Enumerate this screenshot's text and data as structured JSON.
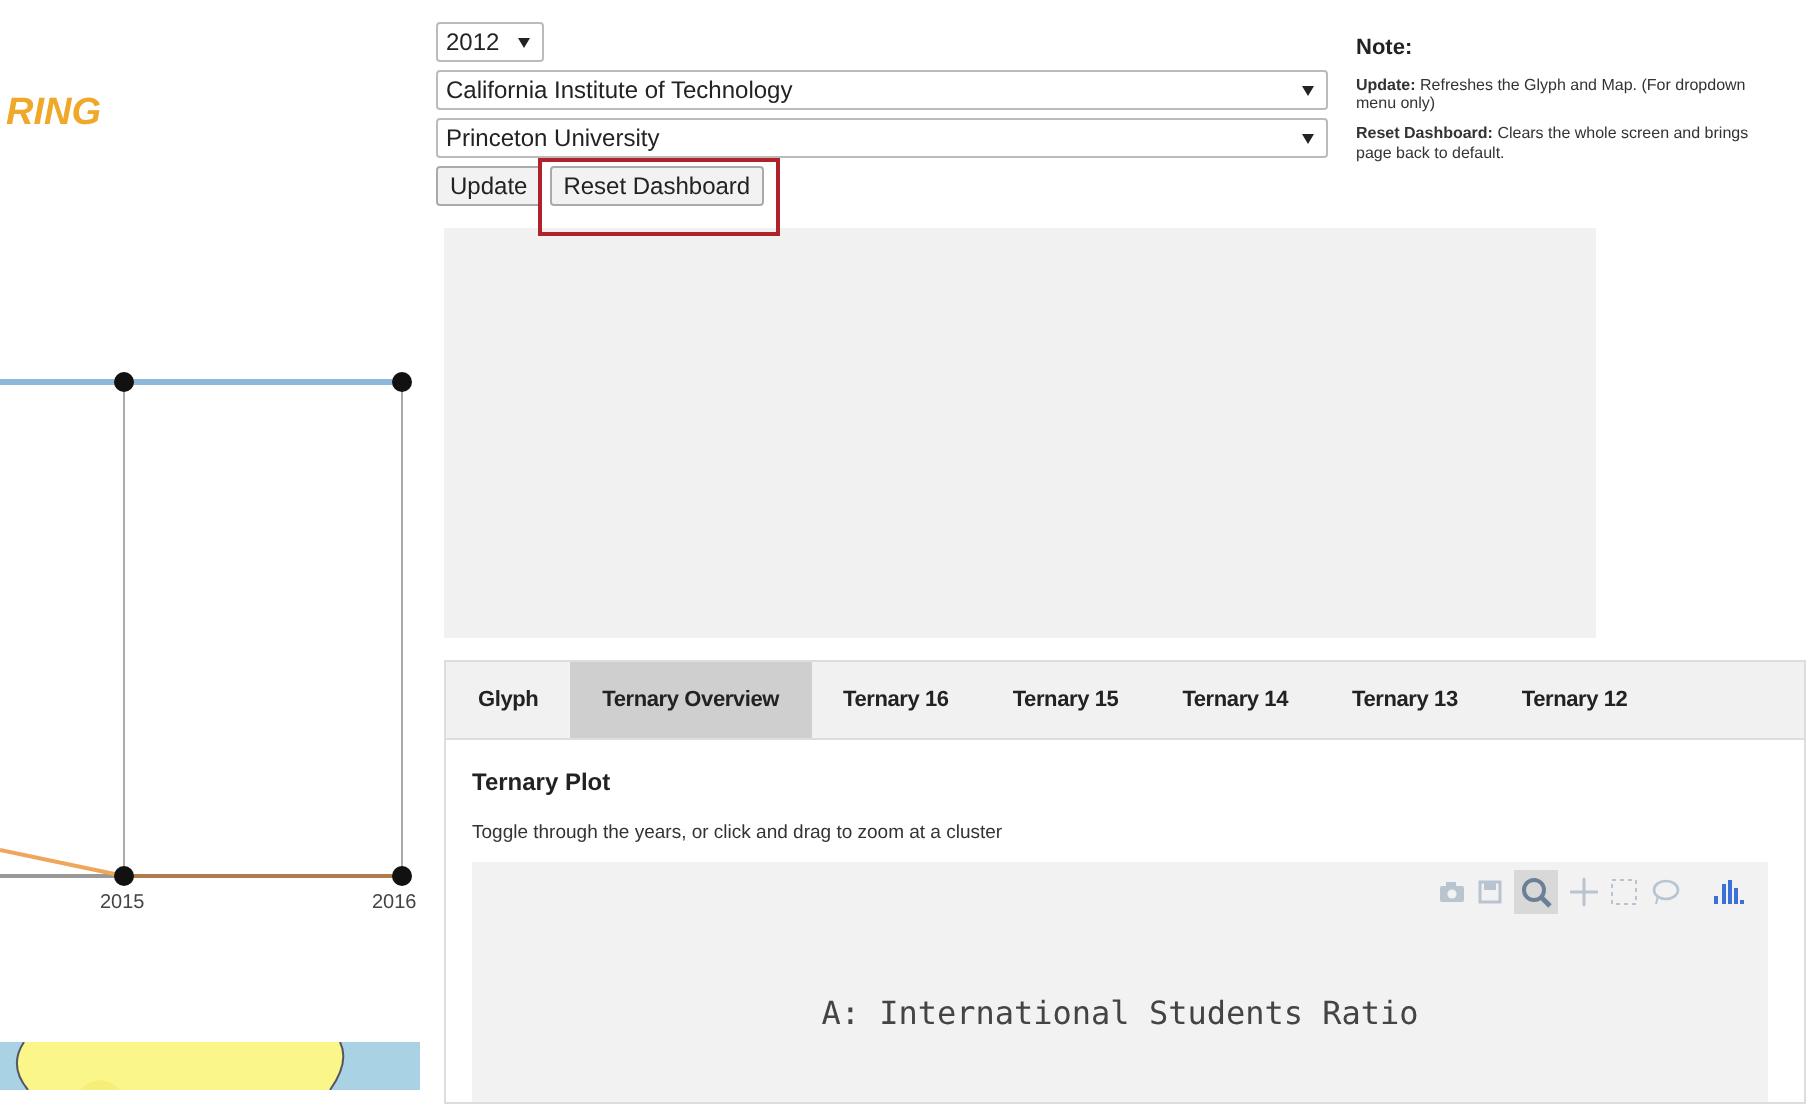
{
  "logo": {
    "text": "RING"
  },
  "trend_chart": {
    "x_labels": [
      "2015",
      "2016"
    ]
  },
  "controls": {
    "year": "2012",
    "university_1": "California Institute of Technology",
    "university_2": "Princeton University",
    "buttons": [
      {
        "label": "Update",
        "highlighted": false
      },
      {
        "label": "Reset Dashboard",
        "highlighted": true
      }
    ]
  },
  "note": {
    "title": "Note:",
    "items": [
      "**Update:** Refreshes the Glyph and Map. (For dropdown menu only)",
      "**Reset Dashboard:** Clears the whole screen and brings page back to default."
    ]
  },
  "tabs": [
    {
      "label": "Glyph",
      "selected": false
    },
    {
      "label": "Ternary Overview",
      "selected": true
    },
    {
      "label": "Ternary 16",
      "selected": false
    },
    {
      "label": "Ternary 15",
      "selected": false
    },
    {
      "label": "Ternary 14",
      "selected": false
    },
    {
      "label": "Ternary 13",
      "selected": false
    },
    {
      "label": "Ternary 12",
      "selected": false
    }
  ],
  "panel": {
    "title": "Ternary Plot",
    "description": "Toggle through the years, or click and drag to zoom at a cluster",
    "plot_title": "A: International Students Ratio"
  }
}
